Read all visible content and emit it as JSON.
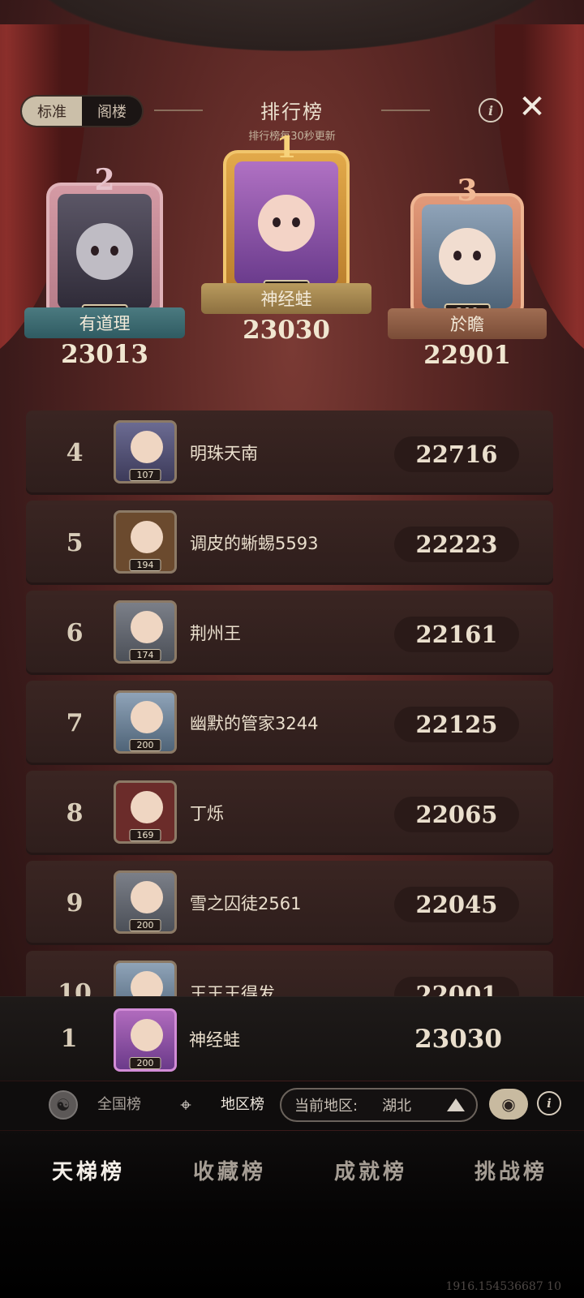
{
  "header": {
    "mode_options": [
      "标准",
      "阁楼"
    ],
    "title": "排行榜",
    "subtitle": "排行榜每30秒更新",
    "info_icon": "info-icon",
    "close_icon": "close-icon"
  },
  "podium": [
    {
      "rank": "2",
      "name": "有道理",
      "level": "200",
      "score": "23013"
    },
    {
      "rank": "1",
      "name": "神经蛙",
      "level": "200",
      "score": "23030"
    },
    {
      "rank": "3",
      "name": "於瞻",
      "level": "200",
      "score": "22901"
    }
  ],
  "rows": [
    {
      "rank": "4",
      "name": "明珠天南",
      "level": "107",
      "score": "22716"
    },
    {
      "rank": "5",
      "name": "调皮的蜥蜴5593",
      "level": "194",
      "score": "22223"
    },
    {
      "rank": "6",
      "name": "荆州王",
      "level": "174",
      "score": "22161"
    },
    {
      "rank": "7",
      "name": "幽默的管家3244",
      "level": "200",
      "score": "22125"
    },
    {
      "rank": "8",
      "name": "丁烁",
      "level": "169",
      "score": "22065"
    },
    {
      "rank": "9",
      "name": "雪之囚徒2561",
      "level": "200",
      "score": "22045"
    },
    {
      "rank": "10",
      "name": "王王王得发",
      "level": "",
      "score": "22001"
    }
  ],
  "self": {
    "rank": "1",
    "name": "神经蛙",
    "level": "200",
    "score": "23030"
  },
  "region_bar": {
    "national_label": "全国榜",
    "region_label": "地区榜",
    "current_region_label": "当前地区:",
    "current_region_value": "湖北"
  },
  "bottom_tabs": [
    "天梯榜",
    "收藏榜",
    "成就榜",
    "挑战榜"
  ],
  "footer_coord": "1916.154536687 10"
}
